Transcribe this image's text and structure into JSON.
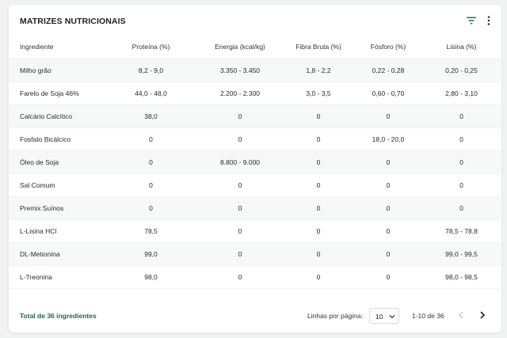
{
  "card": {
    "title": "MATRIZES NUTRICIONAIS",
    "filter_icon": "filter-icon",
    "more_icon": "more-vertical-icon"
  },
  "table": {
    "columns": [
      "Ingrediente",
      "Proteína (%)",
      "Energia (kcal/kg)",
      "Fibra Bruta (%)",
      "Fósforo (%)",
      "Lisina (%)"
    ],
    "rows": [
      [
        "Milho grão",
        "8,2 - 9,0",
        "3.350 - 3.450",
        "1,8 - 2,2",
        "0,22 - 0,28",
        "0,20 - 0,25"
      ],
      [
        "Farelo de Soja 46%",
        "44,0 - 48,0",
        "2.200 - 2.300",
        "3,0 - 3,5",
        "0,60 - 0,70",
        "2,80 - 3,10"
      ],
      [
        "Calcário Calcítico",
        "38,0",
        "0",
        "0",
        "0",
        "0"
      ],
      [
        "Fosfato Bicálcico",
        "0",
        "0",
        "0",
        "18,0 - 20,0",
        "0"
      ],
      [
        "Óleo de Soja",
        "0",
        "8.800 - 9.000",
        "0",
        "0",
        "0"
      ],
      [
        "Sal Comum",
        "0",
        "0",
        "0",
        "0",
        "0"
      ],
      [
        "Premix Suínos",
        "0",
        "0",
        "0",
        "0",
        "0"
      ],
      [
        "L-Lisina HCl",
        "78,5",
        "0",
        "0",
        "0",
        "78,5 - 78,8"
      ],
      [
        "DL-Metionina",
        "99,0",
        "0",
        "0",
        "0",
        "99,0 - 99,5"
      ],
      [
        "L-Treonina",
        "98,0",
        "0",
        "0",
        "0",
        "98,0 - 98,5"
      ]
    ]
  },
  "footer": {
    "total": "Total de 36 ingredientes",
    "rows_label": "Linhas por página:",
    "rows_value": "10",
    "range": "1-10 de 36",
    "prev_icon": "chevron-left-icon",
    "next_icon": "chevron-right-icon"
  },
  "colors": {
    "accent_green": "#1f6b3b",
    "filter_icon": "#1f7a45",
    "row_stripe": "#f7f8f8"
  }
}
